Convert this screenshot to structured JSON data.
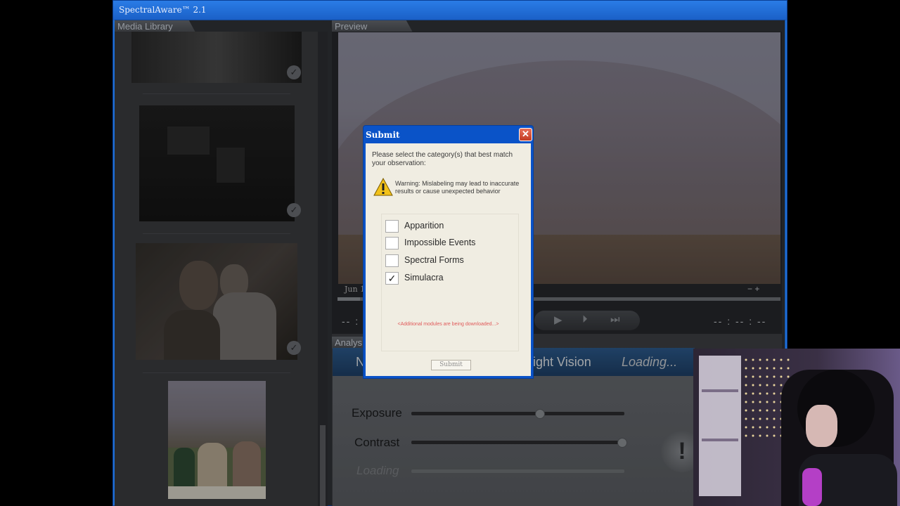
{
  "app": {
    "title": "SpectralAware™ 2.1"
  },
  "panels": {
    "library": "Media Library",
    "preview": "Preview",
    "analysis": "Analys"
  },
  "preview": {
    "date_stamp": "Jun 19",
    "time_left": "-- : -- : --",
    "time_right": "-- : -- : --",
    "zoom": "− +",
    "progress": 0.05
  },
  "analysis": {
    "modes": [
      "N",
      "ight Vision",
      "Loading..."
    ],
    "controls": [
      {
        "label": "Exposure",
        "level": 0.6
      },
      {
        "label": "Contrast",
        "level": 1.0
      },
      {
        "label": "Loading",
        "level": 0.5
      }
    ],
    "big_button": "!"
  },
  "dialog": {
    "title": "Submit",
    "close": "✕",
    "prompt": "Please select the category(s) that best match your observation:",
    "warning": "Warning: Mislabeling may lead to inaccurate results or cause unexpected behavior",
    "categories": [
      {
        "label": "Apparition",
        "checked": false
      },
      {
        "label": "Impossible Events",
        "checked": false
      },
      {
        "label": "Spectral Forms",
        "checked": false
      },
      {
        "label": "Simulacra",
        "checked": true
      }
    ],
    "modules_message": "<Additional modules are being downloaded...>",
    "submit": "Submit"
  },
  "icons": {
    "check": "check-icon",
    "warning": "warning-icon",
    "close": "close-icon"
  },
  "colors": {
    "title_blue": "#1f6fd6",
    "dialog_blue": "#0a53c8",
    "close_red": "#c23b22",
    "warn_yellow": "#f2c21a"
  }
}
